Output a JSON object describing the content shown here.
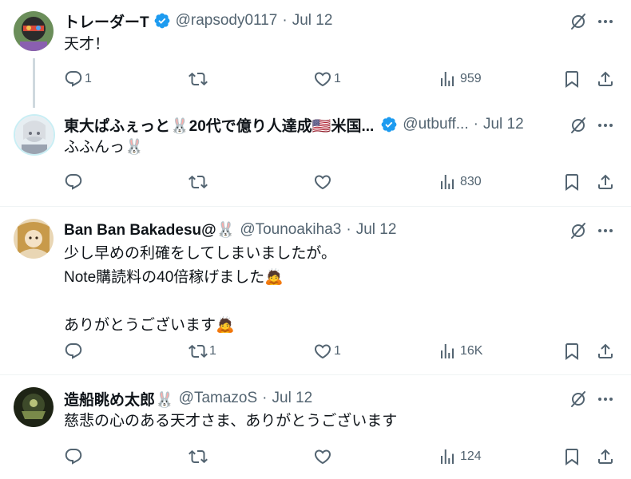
{
  "posts": [
    {
      "name": "トレーダーT",
      "verified": true,
      "handle": "@rapsody0117",
      "dot": "·",
      "time": "Jul 12",
      "lines": [
        "天才！"
      ],
      "actions": {
        "reply": "1",
        "repost": "",
        "like": "1",
        "views": "959"
      }
    },
    {
      "name": "東大ぱふぇっと🐰20代で億り人達成🇺🇸米国...",
      "verified": true,
      "handle": "@utbuff...",
      "dot": "·",
      "time": "Jul 12",
      "lines": [
        "ふふんっ🐰"
      ],
      "actions": {
        "reply": "",
        "repost": "",
        "like": "",
        "views": "830"
      }
    },
    {
      "name": "Ban Ban Bakadesu@🐰",
      "verified": false,
      "handle": "@Tounoakiha3",
      "dot": "·",
      "time": "Jul 12",
      "lines": [
        "少し早めの利確をしてしまいましたが。",
        "Note購読料の40倍稼げました🙇",
        "",
        "ありがとうございます🙇"
      ],
      "actions": {
        "reply": "",
        "repost": "1",
        "like": "1",
        "views": "16K"
      }
    },
    {
      "name": "造船眺め太郎🐰",
      "verified": false,
      "handle": "@TamazoS",
      "dot": "·",
      "time": "Jul 12",
      "lines": [
        "慈悲の心のある天才さま、ありがとうございます"
      ],
      "actions": {
        "reply": "",
        "repost": "",
        "like": "",
        "views": "124"
      }
    }
  ],
  "colors": {
    "text": "#0f1419",
    "muted": "#536471",
    "verified": "#1d9bf0",
    "border": "#eff3f4"
  }
}
